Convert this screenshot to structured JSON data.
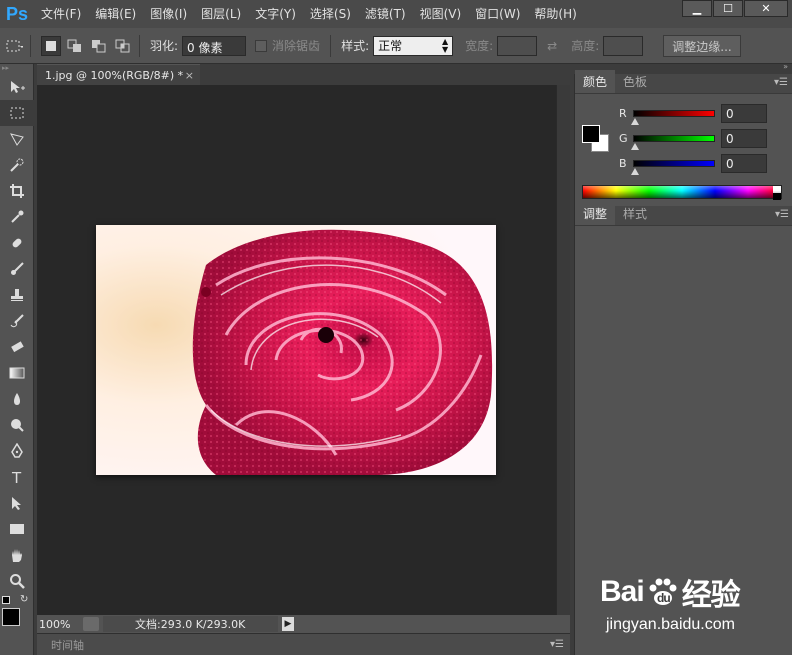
{
  "app": {
    "logo": "Ps"
  },
  "menu": [
    "文件(F)",
    "编辑(E)",
    "图像(I)",
    "图层(L)",
    "文字(Y)",
    "选择(S)",
    "滤镜(T)",
    "视图(V)",
    "窗口(W)",
    "帮助(H)"
  ],
  "window_controls": {
    "minimize": "▁",
    "maximize": "☐",
    "close": "✕"
  },
  "options": {
    "feather_label": "羽化:",
    "feather_value": "0 像素",
    "antialias_label": "消除锯齿",
    "style_label": "样式:",
    "style_value": "正常",
    "width_label": "宽度:",
    "height_label": "高度:",
    "refine_edge": "调整边缘..."
  },
  "tools": [
    "move-icon",
    "marquee-icon",
    "lasso-icon",
    "quick-select-icon",
    "crop-icon",
    "eyedropper-icon",
    "healing-icon",
    "brush-icon",
    "stamp-icon",
    "history-brush-icon",
    "eraser-icon",
    "gradient-icon",
    "blur-icon",
    "dodge-icon",
    "pen-icon",
    "type-icon",
    "path-select-icon",
    "shape-icon",
    "hand-icon",
    "zoom-icon"
  ],
  "document": {
    "tab_title": "1.jpg @ 100%(RGB/8#) *",
    "tab_close": "×",
    "zoom": "100%",
    "doc_size": "文档:293.0 K/293.0K"
  },
  "timeline": {
    "label": "时间轴"
  },
  "color_panel": {
    "tabs": [
      "颜色",
      "色板"
    ],
    "r_label": "R",
    "r_value": "0",
    "g_label": "G",
    "g_value": "0",
    "b_label": "B",
    "b_value": "0",
    "foreground": "#000000",
    "background": "#ffffff"
  },
  "adjust_panel": {
    "tabs": [
      "调整",
      "样式"
    ]
  },
  "watermark": {
    "main_left": "Bai",
    "main_right": "经验",
    "sub": "jingyan.baidu.com"
  },
  "colors": {
    "accent": "#31a8ff",
    "workspace": "#282828",
    "panel": "#535353"
  }
}
